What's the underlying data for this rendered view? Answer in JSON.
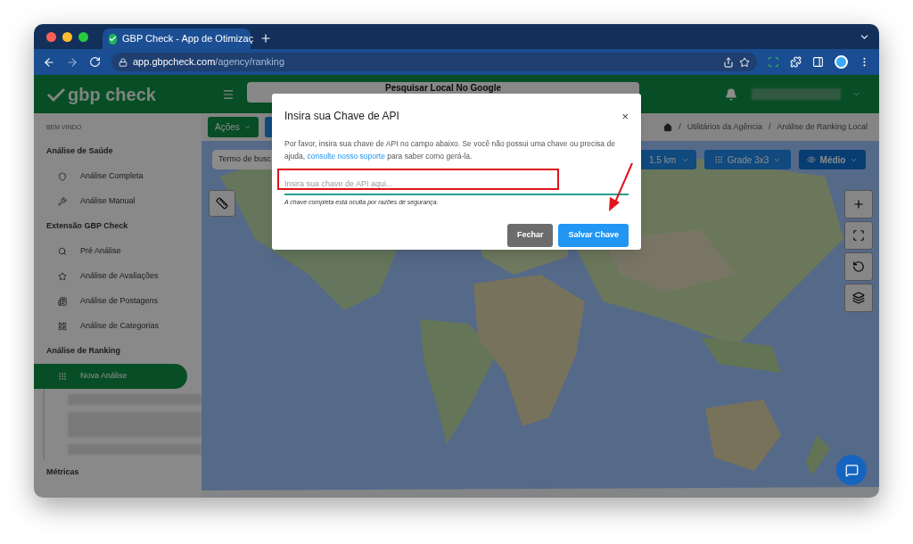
{
  "browser": {
    "tab_title": "GBP Check - App de Otimizaç",
    "url_host": "app.gbpcheck.com",
    "url_path": "/agency/ranking"
  },
  "header": {
    "logo": "gbp check",
    "search_placeholder": "Pesquisar Local No Google"
  },
  "breadcrumb": {
    "separator": "/",
    "items": [
      "Utilitários da Agência",
      "Análise de Ranking Local"
    ]
  },
  "sidebar": {
    "welcome": "BEM VINDO",
    "sections": [
      {
        "title": "Análise de Saúde",
        "items": [
          {
            "label": "Análise Completa",
            "kind": "shield",
            "selected": false
          },
          {
            "label": "Análise Manual",
            "kind": "wrench",
            "selected": false
          }
        ]
      },
      {
        "title": "Extensão GBP Check",
        "items": [
          {
            "label": "Pré Análise",
            "kind": "search",
            "selected": false
          },
          {
            "label": "Análise de Avaliações",
            "kind": "star",
            "selected": false
          },
          {
            "label": "Análise de Postagens",
            "kind": "list",
            "selected": false
          },
          {
            "label": "Análise de Categorias",
            "kind": "grid",
            "selected": false
          }
        ]
      },
      {
        "title": "Análise de Ranking",
        "items": [
          {
            "label": "Nova Análise",
            "kind": "dots",
            "selected": true
          }
        ]
      },
      {
        "title": "Métricas"
      }
    ]
  },
  "toolbar": {
    "actions": "Ações",
    "search_placeholder": "Termo de busc",
    "radius": "1.5 km",
    "grid": "Grade 3x3",
    "view": "Médio"
  },
  "modal": {
    "title": "Insira sua Chave de API",
    "close": "×",
    "text_before": "Por favor, insira sua chave de API no campo abaixo. Se você não possui uma chave ou precisa de ajuda, ",
    "link": "consulte nosso suporte",
    "text_after": " para saber como gerá-la.",
    "input_placeholder": "Insira sua chave de API aqui...",
    "hint": "A chave completa está oculta por razões de segurança.",
    "buttons": [
      {
        "label": "Fechar",
        "kind": "secondary"
      },
      {
        "label": "Salvar Chave",
        "kind": "primary"
      }
    ]
  }
}
